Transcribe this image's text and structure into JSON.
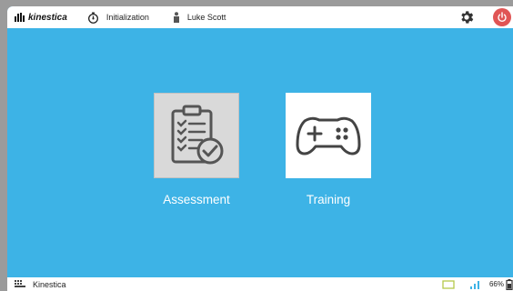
{
  "topbar": {
    "logo_text": "kinestica",
    "session_label": "Initialization",
    "user_name": "Luke Scott",
    "icons": [
      "logo-bars-icon",
      "timer-icon",
      "person-icon",
      "gear-icon",
      "power-icon"
    ]
  },
  "main": {
    "tiles": [
      {
        "label": "Assessment",
        "icon": "clipboard-check-icon"
      },
      {
        "label": "Training",
        "icon": "gamepad-icon"
      }
    ]
  },
  "bottombar": {
    "app_label": "Kinestica",
    "battery_text": "66%",
    "icons": [
      "grid-building-icon",
      "screen-icon",
      "signal-icon",
      "battery-icon"
    ]
  },
  "colors": {
    "background": "#3db3e6",
    "power_button": "#e05555",
    "bar": "#ffffff",
    "tile_assessment": "#d9d9d9",
    "tile_training": "#ffffff"
  }
}
